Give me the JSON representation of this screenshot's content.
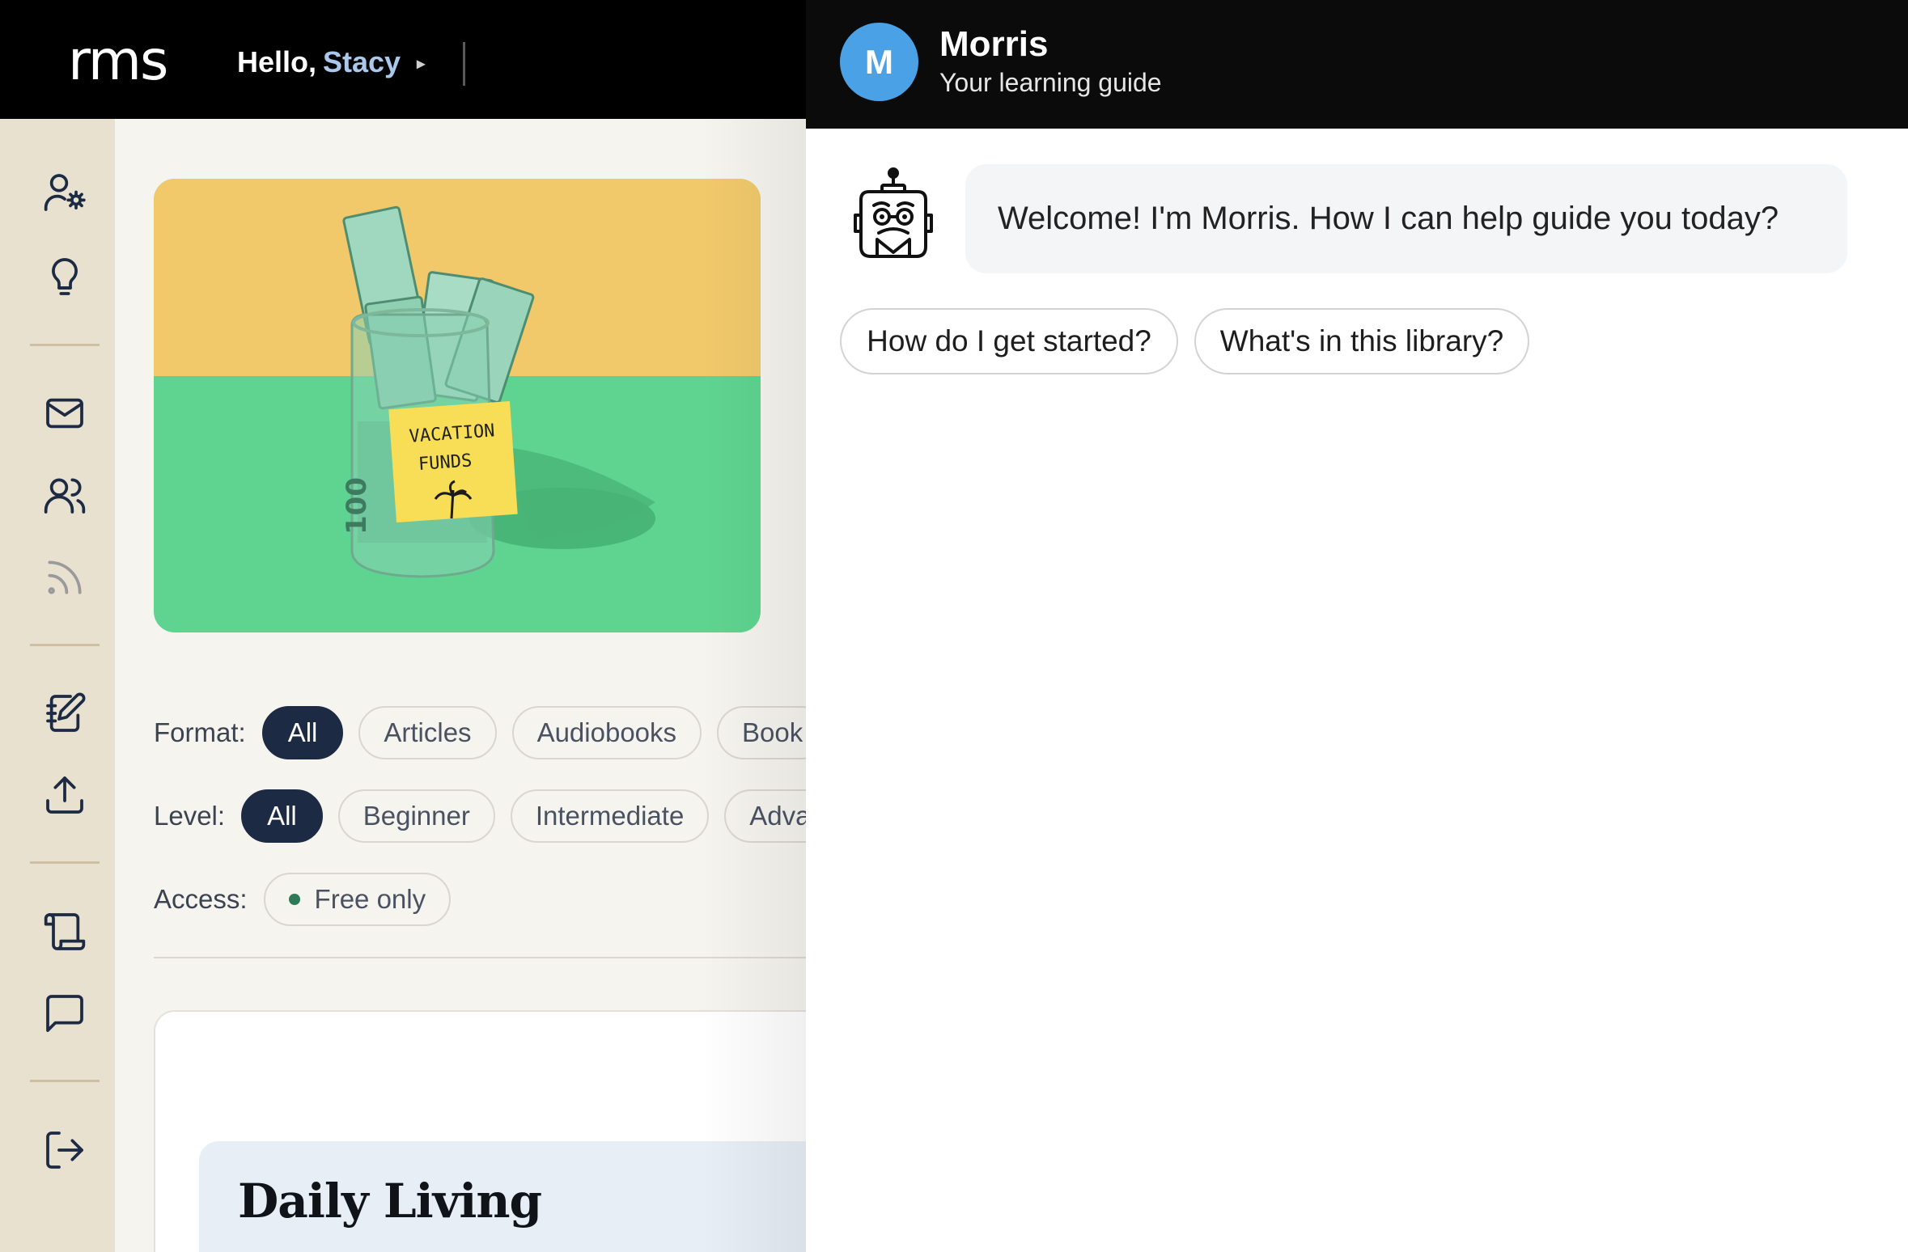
{
  "header": {
    "logo": "rms",
    "greeting": "Hello,",
    "user_name": "Stacy",
    "menu_caret": "▸"
  },
  "sidebar": {
    "items": [
      {
        "icon": "user-settings-icon"
      },
      {
        "icon": "lightbulb-icon"
      },
      {
        "icon": "mail-icon"
      },
      {
        "icon": "users-icon"
      },
      {
        "icon": "rss-feed-icon"
      },
      {
        "icon": "notebook-edit-icon"
      },
      {
        "icon": "upload-icon"
      },
      {
        "icon": "scroll-icon"
      },
      {
        "icon": "chat-bubble-icon"
      },
      {
        "icon": "logout-icon"
      }
    ]
  },
  "hero": {
    "jar_label_line1": "VACATION",
    "jar_label_line2": "FUNDS",
    "bill_value": "100"
  },
  "filters": {
    "format": {
      "label": "Format:",
      "options": [
        "All",
        "Articles",
        "Audiobooks",
        "Book"
      ],
      "selected": "All"
    },
    "level": {
      "label": "Level:",
      "options": [
        "All",
        "Beginner",
        "Intermediate",
        "Adva"
      ],
      "selected": "All"
    },
    "access": {
      "label": "Access:",
      "options": [
        "Free only"
      ],
      "indicator_color": "#2e7a58"
    }
  },
  "section": {
    "title": "Daily Living"
  },
  "chat": {
    "avatar_letter": "M",
    "bot_name": "Morris",
    "bot_subtitle": "Your learning guide",
    "welcome_message": "Welcome! I'm Morris. How I can help guide you today?",
    "suggestions": [
      "How do I get started?",
      "What's in this library?"
    ]
  },
  "colors": {
    "accent_dark": "#1c2a44",
    "username": "#a9c8ec",
    "avatar": "#4ba1e6",
    "sidebar": "#e9e1cf",
    "hero_yellow": "#f1c96b",
    "hero_green": "#5fd490"
  }
}
